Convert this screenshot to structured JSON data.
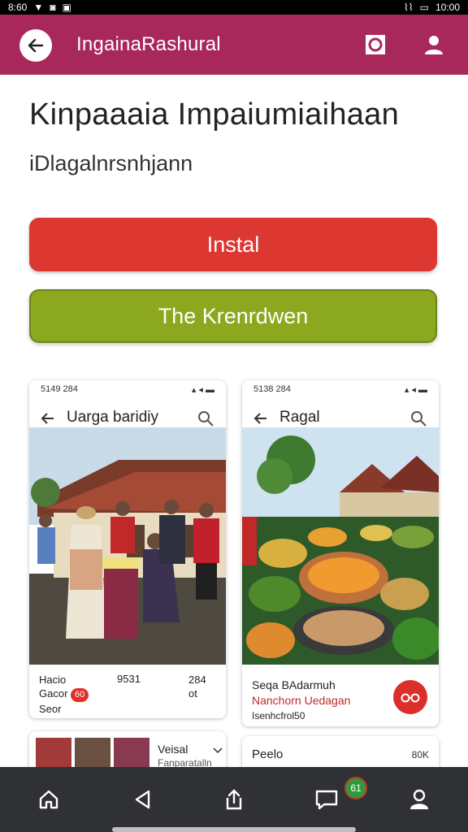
{
  "status_bar": {
    "time": "8:60",
    "right": "10:00"
  },
  "app_bar": {
    "title": "IngainaRashural",
    "back_icon": "back-arrow-icon",
    "square_icon": "square-icon",
    "user_icon": "user-icon",
    "bg": "#a8285c"
  },
  "page": {
    "title": "Kinpaaaia Impaiumiaihaan",
    "subtitle": "iDlagalnrsnhjann",
    "install_label": "Instal",
    "secondary_label": "The Krenrdwen",
    "install_color": "#dc3730",
    "secondary_color": "#8ca81e"
  },
  "cards": [
    {
      "status_time": "5149 284",
      "title": "Uarga baridiy",
      "foot_col1_line1": "Hacio",
      "foot_col1_line2": "Gacor",
      "foot_col1_badge": "60",
      "foot_col1_line3": "Seor",
      "foot_col2": "9531",
      "foot_col3": "284",
      "foot_col3_badge": "ot"
    },
    {
      "status_time": "5138 284",
      "title": "Ragal",
      "foot_line1": "Seqa BAdarmuh",
      "foot_line2": "Nanchorn Uedagan",
      "foot_line3": "Isenhcfrol50"
    }
  ],
  "bottom_cards": [
    {
      "title": "Veisal",
      "subtitle": "Fanparatalln"
    },
    {
      "title": "Peelo",
      "value": "80K"
    }
  ],
  "nav": {
    "items": [
      "home-icon",
      "back-triangle-icon",
      "share-icon",
      "chat-icon",
      "profile-icon"
    ],
    "badge": "61"
  }
}
